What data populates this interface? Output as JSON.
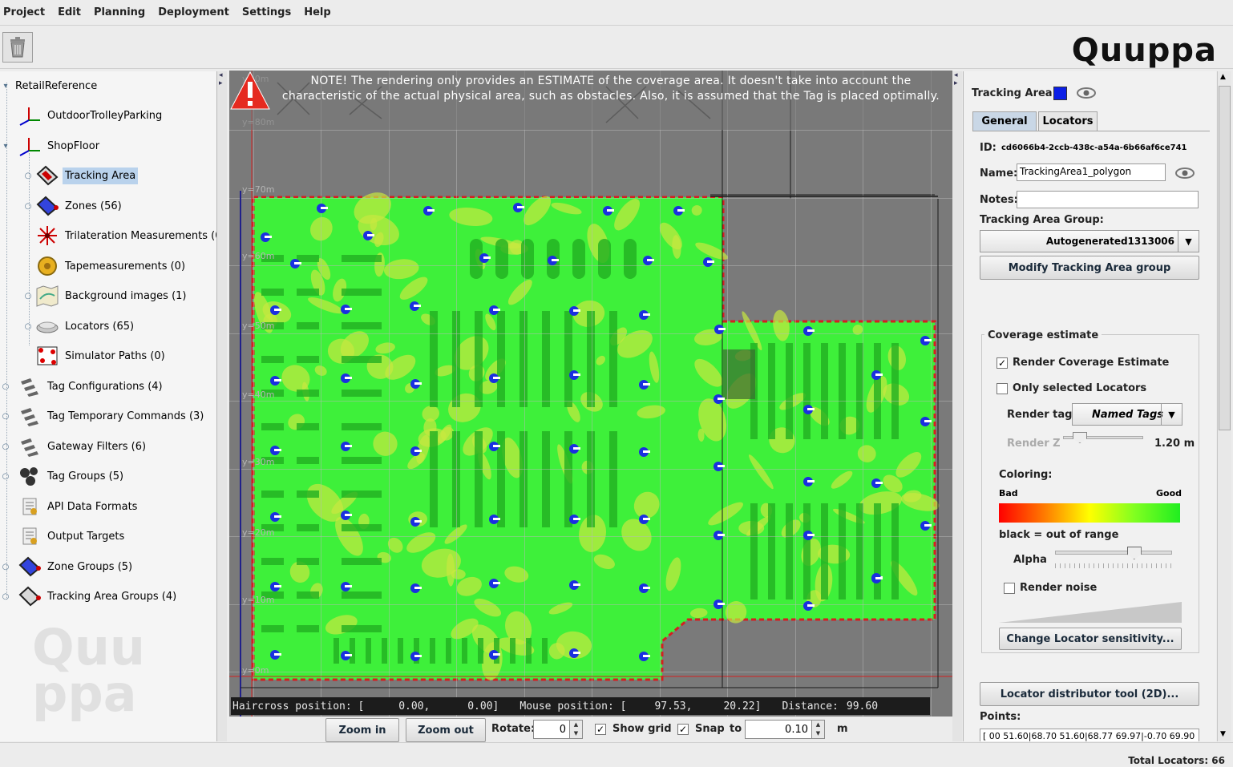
{
  "menu": [
    "Project",
    "Edit",
    "Planning",
    "Deployment",
    "Settings",
    "Help"
  ],
  "logo_text": "Quuppa",
  "tree": {
    "root": "RetailReference",
    "items": [
      {
        "label": "OutdoorTrolleyParking",
        "icon": "axes-icon"
      },
      {
        "label": "ShopFloor",
        "icon": "axes-icon"
      },
      {
        "label": "Tracking Area",
        "icon": "tracking-area-icon"
      },
      {
        "label": "Zones (56)",
        "icon": "zone-icon"
      },
      {
        "label": "Trilateration Measurements (0)",
        "icon": "trilateration-icon"
      },
      {
        "label": "Tapemeasurements (0)",
        "icon": "tape-measure-icon"
      },
      {
        "label": "Background images (1)",
        "icon": "map-icon"
      },
      {
        "label": "Locators (65)",
        "icon": "locator-icon"
      },
      {
        "label": "Simulator Paths (0)",
        "icon": "path-icon"
      },
      {
        "label": "Tag Configurations (4)",
        "icon": "tag-config-icon"
      },
      {
        "label": "Tag Temporary Commands (3)",
        "icon": "tag-command-icon"
      },
      {
        "label": "Gateway Filters (6)",
        "icon": "gateway-filter-icon"
      },
      {
        "label": "Tag Groups (5)",
        "icon": "tag-group-icon"
      },
      {
        "label": "API Data Formats",
        "icon": "api-format-icon"
      },
      {
        "label": "Output Targets",
        "icon": "output-target-icon"
      },
      {
        "label": "Zone Groups (5)",
        "icon": "zone-group-icon"
      },
      {
        "label": "Tracking Area Groups (4)",
        "icon": "tracking-area-group-icon"
      }
    ]
  },
  "view": {
    "note": "NOTE! The rendering only provides an ESTIMATE of the coverage area. It doesn't take into account the characteristic of the actual physical area, such as obstacles. Also, it is assumed that the Tag is placed optimally.",
    "axis_labels": [
      "y=0m",
      "y=80m",
      "y=70m",
      "y=60m",
      "y=50m",
      "y=40m",
      "y=30m",
      "y=20m",
      "y=10m",
      "y=0m"
    ],
    "haircross_label": "Haircross position: [",
    "haircross_x": "0.00,",
    "haircross_y": "0.00]",
    "mouse_label": "Mouse position: [",
    "mouse_x": "97.53,",
    "mouse_y": "20.22]",
    "distance_label": "Distance:",
    "distance_value": "99.60"
  },
  "view_controls": {
    "zoom_in": "Zoom in",
    "zoom_out": "Zoom out",
    "rotate_label": "Rotate:",
    "rotate_value": "0",
    "show_grid": "Show grid",
    "show_grid_checked": true,
    "snap": "Snap",
    "snap_checked": true,
    "to_label": "to",
    "snap_value": "0.10",
    "unit": "m"
  },
  "right_panel": {
    "title": "Tracking Area",
    "color_swatch": "#0b1fe6",
    "tabs": [
      "General",
      "Locators"
    ],
    "active_tab": "General",
    "id_label": "ID:",
    "id_value": "cd6066b4-2ccb-438c-a54a-6b66af6ce741",
    "name_label": "Name:",
    "name_value": "TrackingArea1_polygon",
    "notes_label": "Notes:",
    "notes_value": "",
    "group_label": "Tracking Area Group:",
    "group_value": "Autogenerated1313006",
    "modify_group_button": "Modify Tracking Area group",
    "coverage": {
      "title": "Coverage estimate",
      "render_estimate": "Render Coverage Estimate",
      "render_estimate_checked": true,
      "only_selected": "Only selected Locators",
      "only_selected_checked": false,
      "render_tags_label": "Render tags",
      "render_tags_value": "Named Tags",
      "render_z_label": "Render Z",
      "render_z_value": "1.20 m",
      "render_z_level": 0.2,
      "coloring_label": "Coloring:",
      "bad_label": "Bad",
      "good_label": "Good",
      "out_of_range": "black = out of range",
      "alpha_label": "Alpha",
      "alpha_level": 0.67,
      "render_noise": "Render noise",
      "render_noise_checked": false,
      "sensitivity_button": "Change Locator sensitivity..."
    },
    "distributor_button": "Locator distributor tool (2D)...",
    "points_label": "Points:",
    "points_value": "[ 00 51.60|68.70 51.60|68.77 69.97|-0.70 69.90"
  },
  "status": {
    "total_locators": "Total Locators: 66"
  },
  "colors": {
    "coverage_green": "#3ef03a",
    "coverage_yellow": "#c8e840",
    "locator_blue": "#1a2fe0",
    "boundary_red": "#e02020",
    "selection_blue": "#b9d2ec"
  }
}
